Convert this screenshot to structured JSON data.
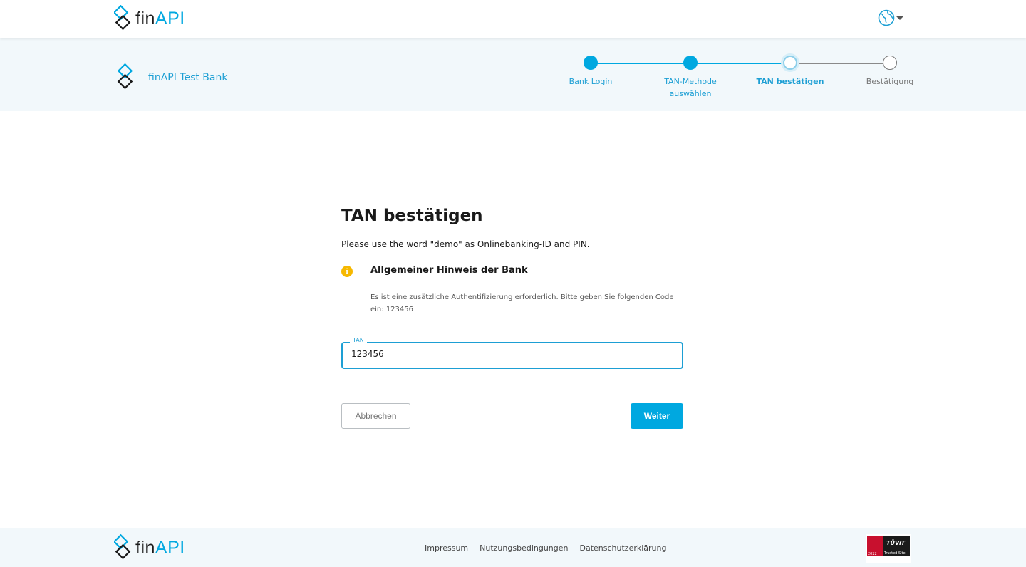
{
  "header": {
    "logo": {
      "fin": "fin",
      "api": "API"
    },
    "language_icon": "globe-icon"
  },
  "bank": {
    "name": "finAPI Test Bank"
  },
  "stepper": {
    "steps": [
      {
        "label": "Bank Login",
        "state": "done"
      },
      {
        "label": "TAN-Methode auswählen",
        "state": "done"
      },
      {
        "label": "TAN bestätigen",
        "state": "current"
      },
      {
        "label": "Bestätigung",
        "state": "todo"
      }
    ]
  },
  "main": {
    "title": "TAN bestätigen",
    "subtitle": "Please use the word \"demo\" as Onlinebanking-ID and PIN.",
    "hint": {
      "icon": "info-icon",
      "title": "Allgemeiner Hinweis der Bank",
      "body": "Es ist eine zusätzliche Authentifizierung erforderlich. Bitte geben Sie folgenden Code ein: 123456"
    },
    "tan_field": {
      "label": "TAN",
      "value": "123456"
    },
    "buttons": {
      "cancel": "Abbrechen",
      "next": "Weiter"
    }
  },
  "footer": {
    "logo": {
      "fin": "fin",
      "api": "API"
    },
    "links": [
      "Impressum",
      "Nutzungsbedingungen",
      "Datenschutzerklärung"
    ],
    "badge": {
      "year": "2022",
      "brand": "TÜViT",
      "caption": "Trusted Site"
    }
  },
  "colors": {
    "accent": "#00a8e0",
    "hint": "#f6b800",
    "panel": "#f2f8fb"
  }
}
